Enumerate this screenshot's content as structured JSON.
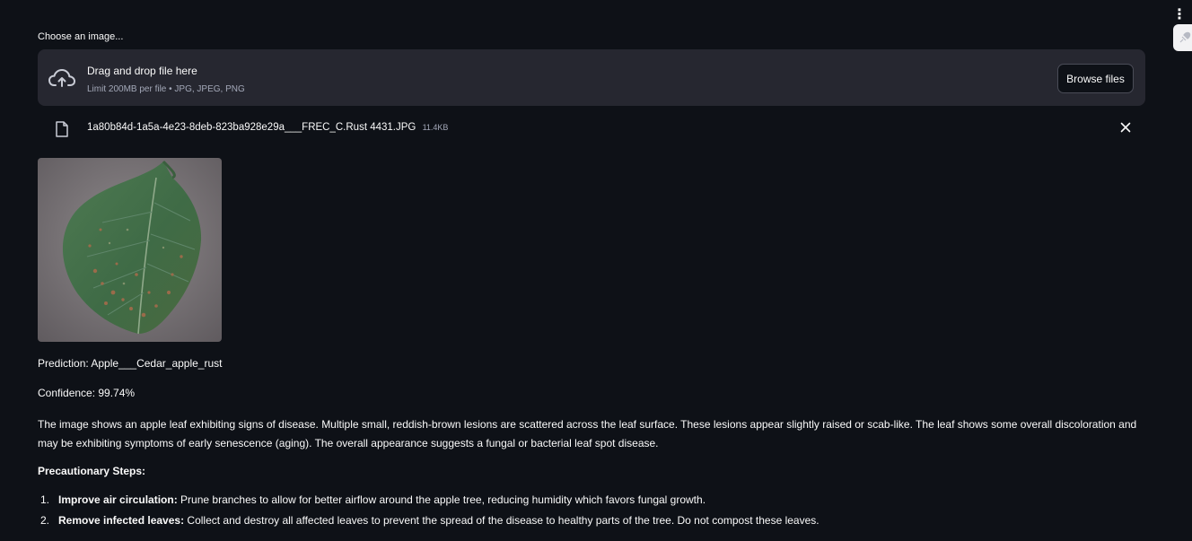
{
  "menu": {
    "icon": "vertical-dots-icon"
  },
  "deploy": {
    "icon": "deploy-icon"
  },
  "uploader": {
    "label": "Choose an image...",
    "title": "Drag and drop file here",
    "subtitle": "Limit 200MB per file • JPG, JPEG, PNG",
    "browse_label": "Browse files"
  },
  "file": {
    "name": "1a80b84d-1a5a-4e23-8deb-823ba928e29a___FREC_C.Rust 4431.JPG",
    "size": "11.4KB"
  },
  "result": {
    "prediction": "Prediction: Apple___Cedar_apple_rust",
    "confidence": "Confidence: 99.74%",
    "description": "The image shows an apple leaf exhibiting signs of disease. Multiple small, reddish-brown lesions are scattered across the leaf surface. These lesions appear slightly raised or scab-like. The leaf shows some overall discoloration and may be exhibiting symptoms of early senescence (aging). The overall appearance suggests a fungal or bacterial leaf spot disease.",
    "steps_heading": "Precautionary Steps:",
    "steps": [
      {
        "num": "1.",
        "title": "Improve air circulation:",
        "text": " Prune branches to allow for better airflow around the apple tree, reducing humidity which favors fungal growth."
      },
      {
        "num": "2.",
        "title": "Remove infected leaves:",
        "text": " Collect and destroy all affected leaves to prevent the spread of the disease to healthy parts of the tree. Do not compost these leaves."
      }
    ]
  },
  "colors": {
    "background": "#0e1117",
    "dropzone": "#262730",
    "text": "#fafafa",
    "muted": "#a3a8b8"
  }
}
